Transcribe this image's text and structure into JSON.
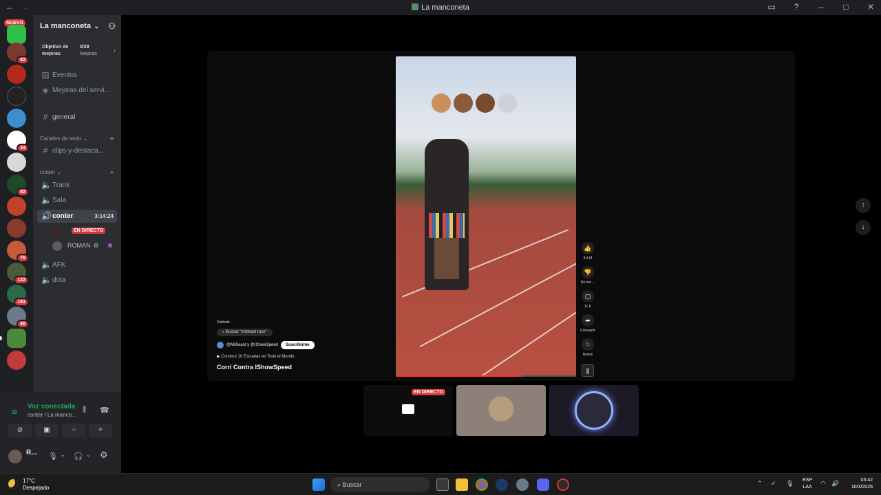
{
  "titlebar": {
    "title": "La manconeta",
    "back": "←",
    "forward": "→"
  },
  "servers": {
    "nuevo": "NUEVO",
    "badges": [
      "82",
      "44",
      "82",
      "76",
      "122",
      "161",
      "80"
    ]
  },
  "guild": {
    "name": "La manconeta",
    "boost_label": "Objetivo de mejoras",
    "boost_value": "0/28",
    "boost_unit": "Mejoras",
    "eventos": "Eventos",
    "mejoras": "Mejoras del servi...",
    "general": "general",
    "cat_text": "Canales de texto",
    "clips": "clips-y-destaca...",
    "cat_conter": "conter",
    "trank": "Trank",
    "sala": "Sala",
    "conter": "conter",
    "timer": "3:14:24",
    "live_label": "EN DIRECTO",
    "roman": "ROMAN",
    "afk": "AFK",
    "dota": "dota"
  },
  "voice": {
    "title": "Voz conectada",
    "sub": "conter / La manco...",
    "user": "R..."
  },
  "video": {
    "dob": "Doblado",
    "search": "Buscar \"mrbeast race\"",
    "channel": "@MrBeast y @IShowSpeed",
    "subscribe": "Suscribirme",
    "promo": "Construí 10 Escuelas en Todo el Mundo",
    "title": "Corrí Contra IShowSpeed",
    "likes": "8,4 M",
    "dislike": "No me ...",
    "comments": "11 K",
    "share": "Compartir",
    "remix": "Remix"
  },
  "tiles": {
    "live": "EN DIRECTO"
  },
  "taskbar": {
    "temp": "17°C",
    "weather": "Despejado",
    "search": "Buscar",
    "lang1": "ESP",
    "lang2": "LAA",
    "time": "03:42",
    "date": "10/3/2026"
  }
}
